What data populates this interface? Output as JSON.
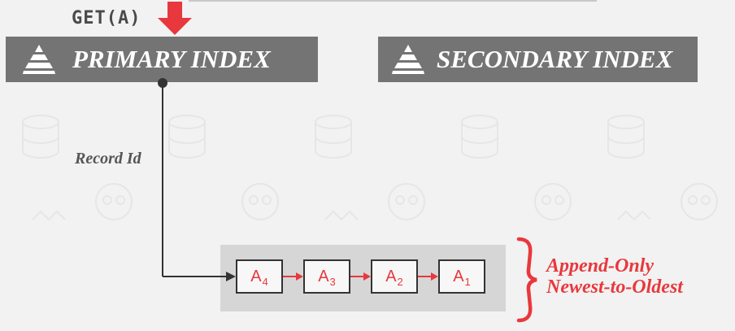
{
  "request": {
    "label": "GET(A)"
  },
  "indexes": {
    "primary": {
      "title": "PRIMARY INDEX",
      "icon": "pyramid-icon"
    },
    "secondary": {
      "title": "SECONDARY INDEX",
      "icon": "pyramid-icon"
    }
  },
  "pointer": {
    "label": "Record Id"
  },
  "version_chain": {
    "nodes": [
      {
        "base": "A",
        "sub": "4"
      },
      {
        "base": "A",
        "sub": "3"
      },
      {
        "base": "A",
        "sub": "2"
      },
      {
        "base": "A",
        "sub": "1"
      }
    ]
  },
  "annotation": {
    "line1": "Append-Only",
    "line2": "Newest-to-Oldest"
  },
  "colors": {
    "accent": "#e8383d",
    "header_bg": "#747474",
    "chain_bg": "#d6d6d6"
  }
}
